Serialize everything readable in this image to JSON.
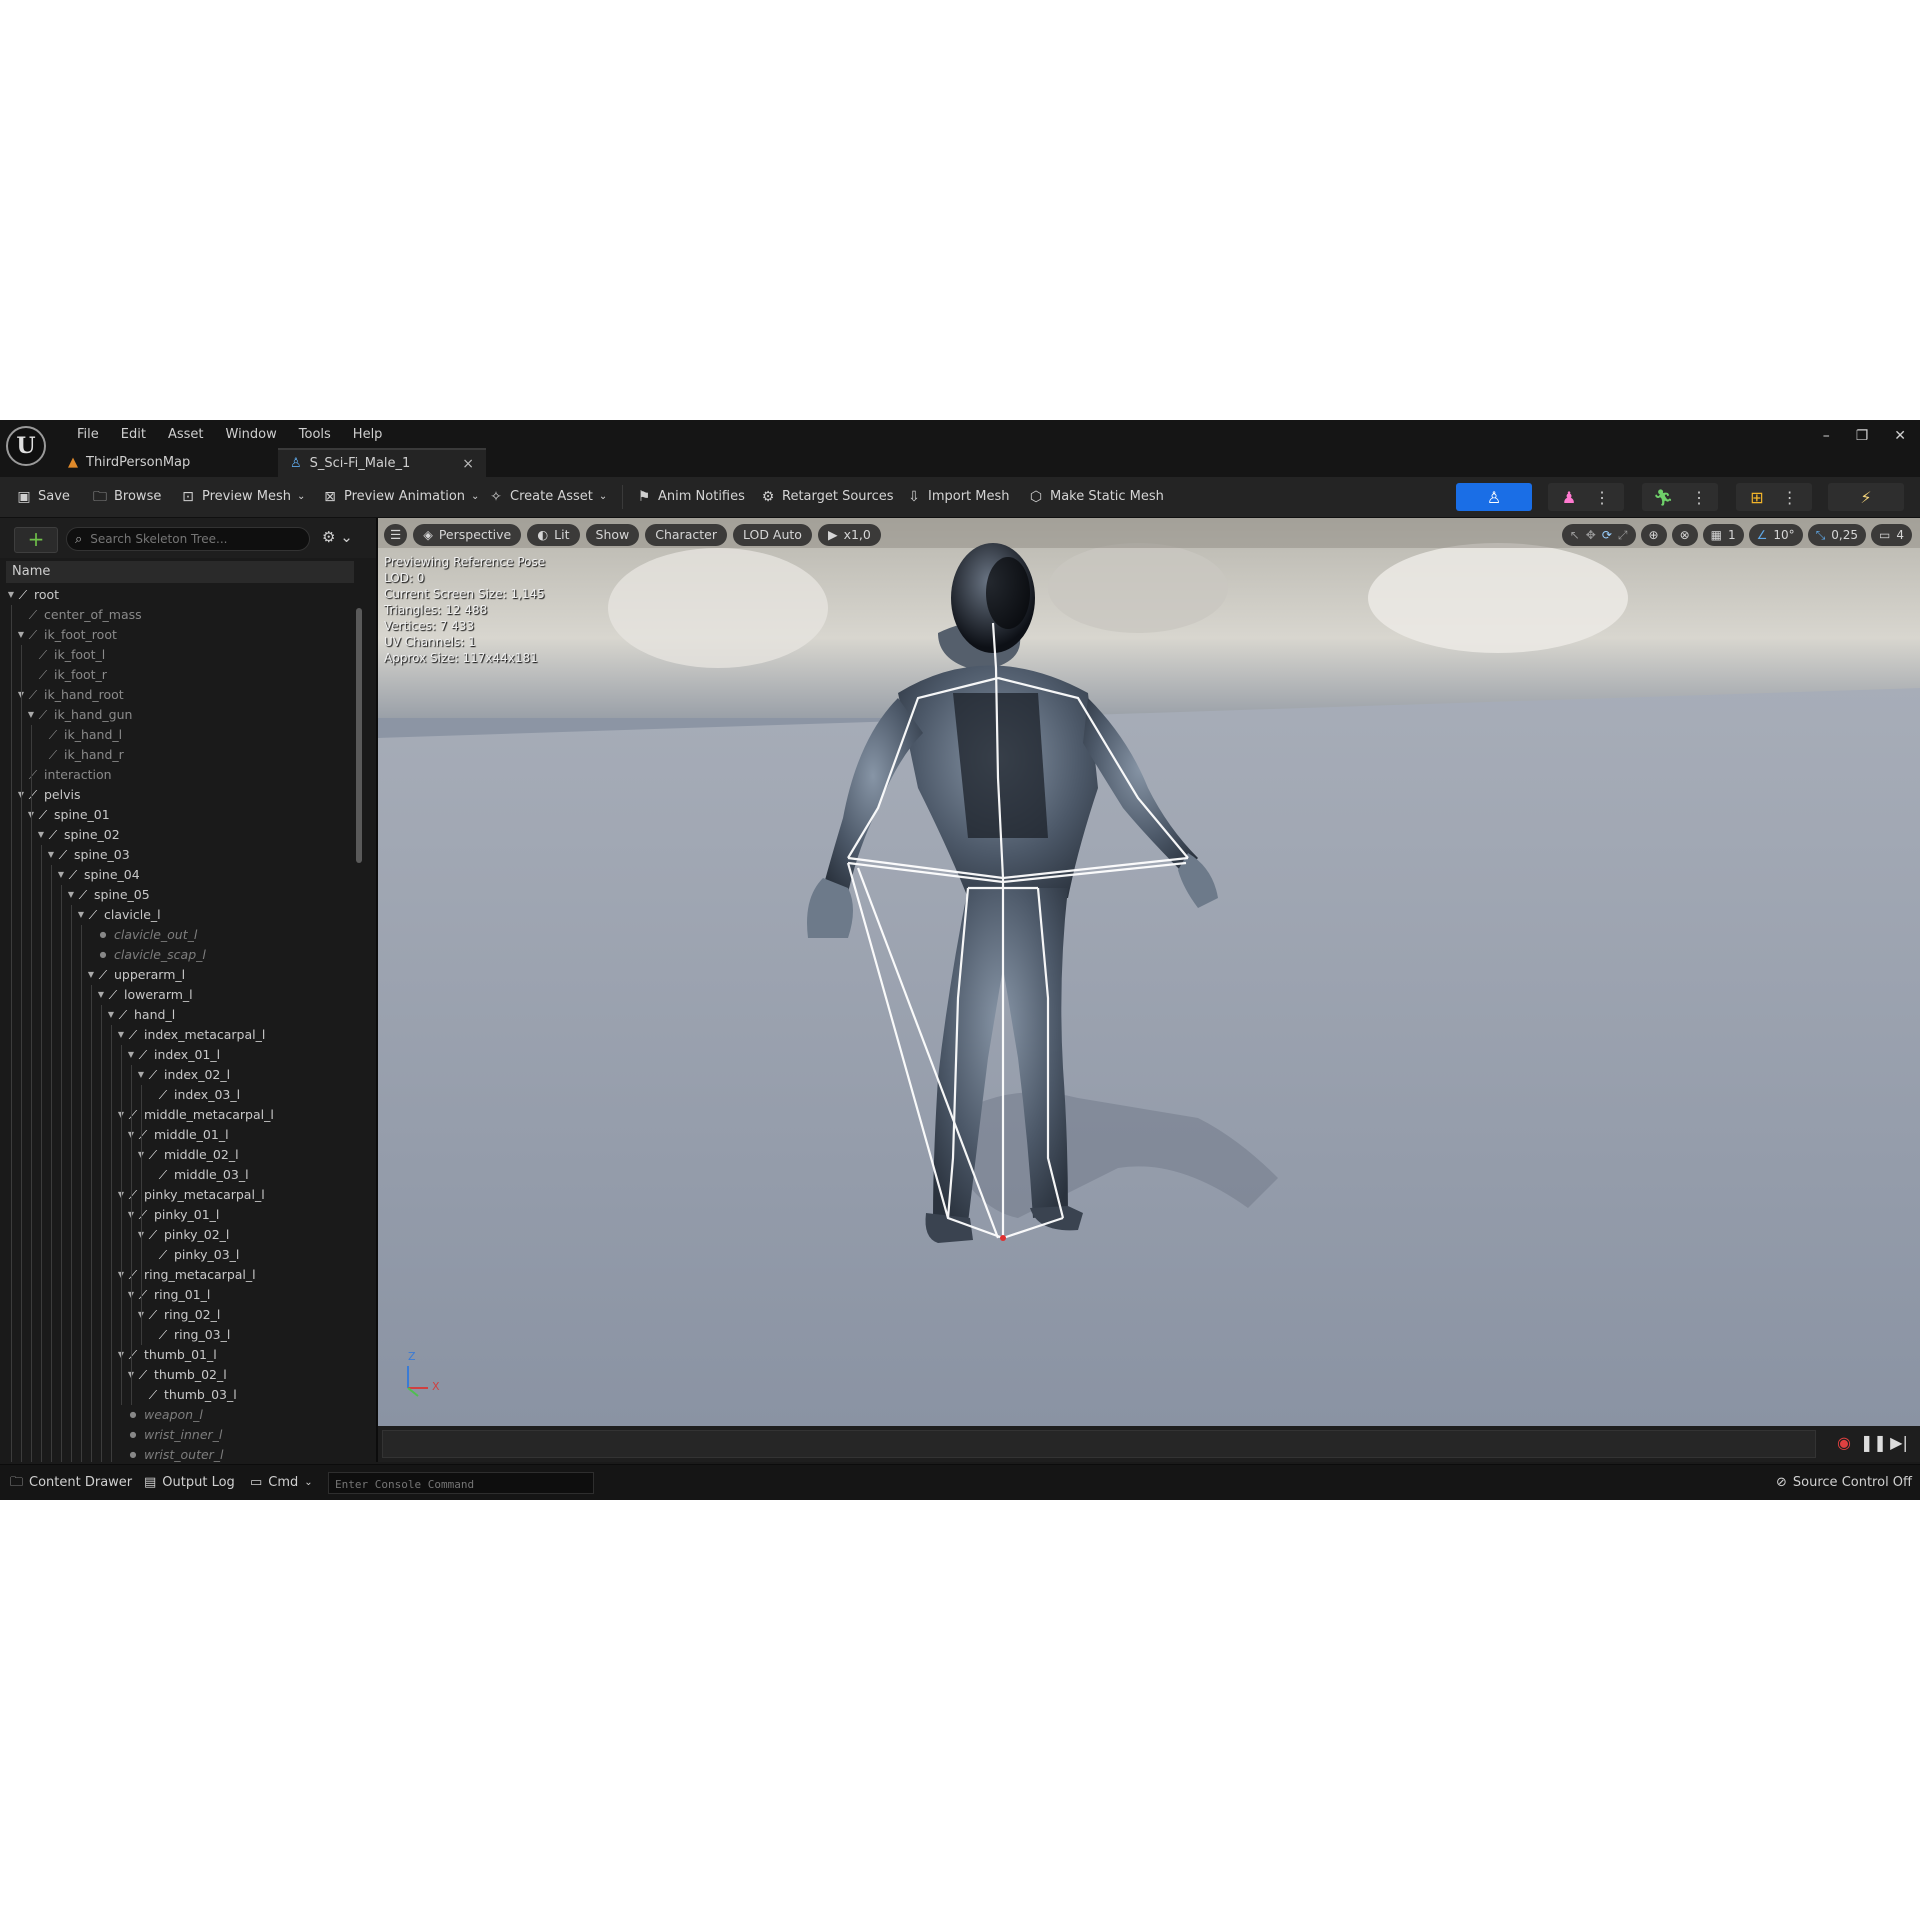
{
  "menubar": {
    "logo_glyph": "U",
    "items": [
      "File",
      "Edit",
      "Asset",
      "Window",
      "Tools",
      "Help"
    ]
  },
  "tabs": [
    {
      "label": "ThirdPersonMap",
      "icon": "level-icon"
    },
    {
      "label": "S_Sci-Fi_Male_1",
      "icon": "skeleton-icon",
      "close": "×"
    }
  ],
  "window_controls": {
    "minimize": "–",
    "restore": "❐",
    "close": "✕"
  },
  "toolbar": {
    "save": "Save",
    "browse": "Browse",
    "preview_mesh": "Preview Mesh",
    "preview_animation": "Preview Animation",
    "create_asset": "Create Asset",
    "anim_notifies": "Anim Notifies",
    "retarget_sources": "Retarget Sources",
    "import_mesh": "Import Mesh",
    "make_static_mesh": "Make Static Mesh",
    "accent": "#1a6ee6"
  },
  "skeleton_tree": {
    "search_placeholder": "Search Skeleton Tree...",
    "add": "+",
    "column_name": "Name",
    "rows": [
      {
        "label": "root",
        "depth": 0,
        "type": "bone",
        "open": true
      },
      {
        "label": "center_of_mass",
        "depth": 1,
        "type": "virtual",
        "open": false
      },
      {
        "label": "ik_foot_root",
        "depth": 1,
        "type": "virtual",
        "open": true
      },
      {
        "label": "ik_foot_l",
        "depth": 2,
        "type": "virtual",
        "open": false
      },
      {
        "label": "ik_foot_r",
        "depth": 2,
        "type": "virtual",
        "open": false
      },
      {
        "label": "ik_hand_root",
        "depth": 1,
        "type": "virtual",
        "open": true
      },
      {
        "label": "ik_hand_gun",
        "depth": 2,
        "type": "virtual",
        "open": true
      },
      {
        "label": "ik_hand_l",
        "depth": 3,
        "type": "virtual",
        "open": false
      },
      {
        "label": "ik_hand_r",
        "depth": 3,
        "type": "virtual",
        "open": false
      },
      {
        "label": "interaction",
        "depth": 1,
        "type": "virtual",
        "open": false
      },
      {
        "label": "pelvis",
        "depth": 1,
        "type": "bone",
        "open": true
      },
      {
        "label": "spine_01",
        "depth": 2,
        "type": "bone",
        "open": true
      },
      {
        "label": "spine_02",
        "depth": 3,
        "type": "bone",
        "open": true
      },
      {
        "label": "spine_03",
        "depth": 4,
        "type": "bone",
        "open": true
      },
      {
        "label": "spine_04",
        "depth": 5,
        "type": "bone",
        "open": true
      },
      {
        "label": "spine_05",
        "depth": 6,
        "type": "bone",
        "open": true
      },
      {
        "label": "clavicle_l",
        "depth": 7,
        "type": "bone",
        "open": true
      },
      {
        "label": "clavicle_out_l",
        "depth": 8,
        "type": "socket",
        "open": false
      },
      {
        "label": "clavicle_scap_l",
        "depth": 8,
        "type": "socket",
        "open": false
      },
      {
        "label": "upperarm_l",
        "depth": 8,
        "type": "bone",
        "open": true
      },
      {
        "label": "lowerarm_l",
        "depth": 9,
        "type": "bone",
        "open": true
      },
      {
        "label": "hand_l",
        "depth": 10,
        "type": "bone",
        "open": true
      },
      {
        "label": "index_metacarpal_l",
        "depth": 11,
        "type": "bone",
        "open": true
      },
      {
        "label": "index_01_l",
        "depth": 12,
        "type": "bone",
        "open": true
      },
      {
        "label": "index_02_l",
        "depth": 13,
        "type": "bone",
        "open": true
      },
      {
        "label": "index_03_l",
        "depth": 14,
        "type": "bone",
        "open": false
      },
      {
        "label": "middle_metacarpal_l",
        "depth": 11,
        "type": "bone",
        "open": true
      },
      {
        "label": "middle_01_l",
        "depth": 12,
        "type": "bone",
        "open": true
      },
      {
        "label": "middle_02_l",
        "depth": 13,
        "type": "bone",
        "open": true
      },
      {
        "label": "middle_03_l",
        "depth": 14,
        "type": "bone",
        "open": false
      },
      {
        "label": "pinky_metacarpal_l",
        "depth": 11,
        "type": "bone",
        "open": true
      },
      {
        "label": "pinky_01_l",
        "depth": 12,
        "type": "bone",
        "open": true
      },
      {
        "label": "pinky_02_l",
        "depth": 13,
        "type": "bone",
        "open": true
      },
      {
        "label": "pinky_03_l",
        "depth": 14,
        "type": "bone",
        "open": false
      },
      {
        "label": "ring_metacarpal_l",
        "depth": 11,
        "type": "bone",
        "open": true
      },
      {
        "label": "ring_01_l",
        "depth": 12,
        "type": "bone",
        "open": true
      },
      {
        "label": "ring_02_l",
        "depth": 13,
        "type": "bone",
        "open": true
      },
      {
        "label": "ring_03_l",
        "depth": 14,
        "type": "bone",
        "open": false
      },
      {
        "label": "thumb_01_l",
        "depth": 11,
        "type": "bone",
        "open": true
      },
      {
        "label": "thumb_02_l",
        "depth": 12,
        "type": "bone",
        "open": true
      },
      {
        "label": "thumb_03_l",
        "depth": 13,
        "type": "bone",
        "open": false
      },
      {
        "label": "weapon_l",
        "depth": 11,
        "type": "socket",
        "open": false
      },
      {
        "label": "wrist_inner_l",
        "depth": 11,
        "type": "socket",
        "open": false
      },
      {
        "label": "wrist_outer_l",
        "depth": 11,
        "type": "socket",
        "open": false
      }
    ]
  },
  "viewport": {
    "perspective": "Perspective",
    "lit": "Lit",
    "show": "Show",
    "character": "Character",
    "lod": "LOD Auto",
    "play": "x1,0",
    "grid_value": "1",
    "angle_value": "10°",
    "scale_value": "0,25",
    "camera_value": "4",
    "stats": [
      "Previewing Reference Pose",
      "LOD: 0",
      "Current Screen Size: 1,145",
      "Triangles: 12 488",
      "Vertices: 7 433",
      "UV Channels: 1",
      "Approx Size: 117x44x181"
    ],
    "axis_z": "Z",
    "axis_x": "X"
  },
  "statusbar": {
    "content_drawer": "Content Drawer",
    "output_log": "Output Log",
    "cmd": "Cmd",
    "console_placeholder": "Enter Console Command",
    "source_control": "Source Control Off"
  }
}
